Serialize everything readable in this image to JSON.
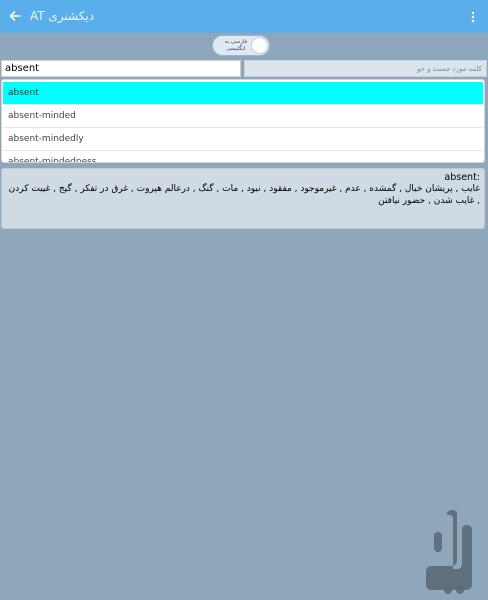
{
  "appbar": {
    "title": "دیکشنری AT",
    "back_icon": "arrow-left-icon",
    "menu_icon": "more-vertical-icon"
  },
  "lang_toggle": {
    "label": "فارسی به انگلیسی",
    "state": "off"
  },
  "search": {
    "value": "absent",
    "farsi_placeholder": "کلمه مورد جست و جو"
  },
  "suggestions": [
    {
      "label": "absent",
      "selected": true
    },
    {
      "label": "absent-minded",
      "selected": false
    },
    {
      "label": "absent-mindedly",
      "selected": false
    },
    {
      "label": "absent-mindedness",
      "selected": false
    }
  ],
  "result": {
    "word": "absent:",
    "meaning": "غایب , پریشان خیال , گمشده , عدم , غیرموجود , مفقود , نبود , مات , گنگ , درعالم هپروت , غرق در تفکر , گیج , غیبت کردن , غایب شدن , حضور نیافتن"
  },
  "colors": {
    "appbar": "#5aaee9",
    "background": "#8fa7ba",
    "selected_row": "#00ffff",
    "result_bg": "#cfdae3"
  },
  "watermark_icon": "store-logo-icon"
}
